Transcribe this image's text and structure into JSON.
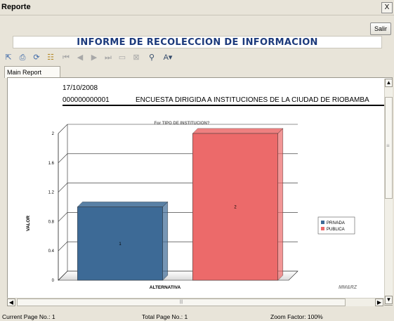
{
  "window": {
    "title": "Reporte",
    "close_glyph": "X"
  },
  "buttons": {
    "salir": "Salir"
  },
  "header": {
    "title": "INFORME DE RECOLECCION DE INFORMACION"
  },
  "toolbar": {
    "icons": [
      "export-icon",
      "print-icon",
      "refresh-icon",
      "group-tree-icon",
      "first-page-icon",
      "previous-page-icon",
      "next-page-icon",
      "last-page-icon",
      "go-to-page-icon",
      "close-view-icon",
      "search-icon",
      "zoom-icon"
    ],
    "zoom_dropdown_glyph": "▾"
  },
  "tabs": [
    {
      "label": "Main Report"
    }
  ],
  "report": {
    "date": "17/10/2008",
    "code": "000000000001",
    "survey_title": "ENCUESTA DIRIGIDA A INSTITUCIONES DE LA CIUDAD DE RIOBAMBA",
    "watermark": "MM&RZ"
  },
  "chart_data": {
    "type": "bar",
    "title": "For TIPO DE INSTITUCION?",
    "xlabel": "ALTERNATIVA",
    "ylabel": "VALOR",
    "ylim": [
      0,
      2
    ],
    "yticks": [
      0,
      0.4,
      0.8,
      1.2,
      1.6,
      2
    ],
    "series": [
      {
        "name": "PRIVADA",
        "value": 1,
        "label": "1",
        "color": "#3d6a96"
      },
      {
        "name": "PUBLICA",
        "value": 2,
        "label": "2",
        "color": "#ec6a6a"
      }
    ],
    "grid": true,
    "legend_placement": "right"
  },
  "status": {
    "current_page": "Current Page No.: 1",
    "total_pages": "Total Page No.: 1",
    "zoom": "Zoom Factor: 100%"
  },
  "scroll_glyphs": {
    "up": "▲",
    "down": "▼",
    "left": "◀",
    "right": "▶",
    "grip": "|||",
    "vgrip": "≡"
  }
}
